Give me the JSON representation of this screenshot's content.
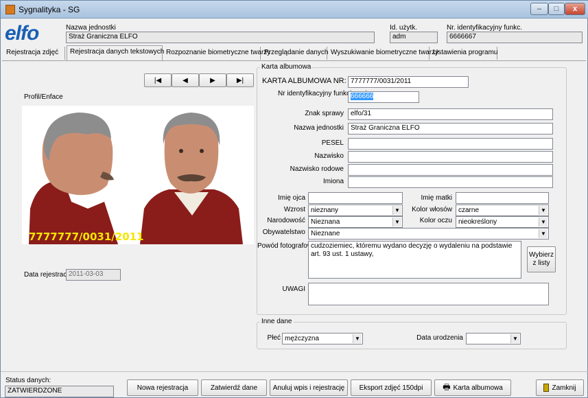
{
  "window": {
    "title": "Sygnalityka - SG",
    "controls": {
      "minimize": "–",
      "maximize": "□",
      "close": "x"
    }
  },
  "header": {
    "logo": "elfo",
    "unit_label": "Nazwa jednostki",
    "unit_value": "Straż Graniczna ELFO",
    "user_label": "Id. użytk.",
    "user_value": "adm",
    "officer_label": "Nr. identyfikacyjny funkc.",
    "officer_value": "6666667"
  },
  "tabs": [
    {
      "label": "Rejestracja zdjęć"
    },
    {
      "label": "Rejestracja danych tekstowych"
    },
    {
      "label": "Rozpoznanie biometryczne twarzy"
    },
    {
      "label": "Przeglądanie danych"
    },
    {
      "label": "Wyszukiwanie biometryczne twarzy"
    },
    {
      "label": "Ustawienia programu"
    }
  ],
  "nav": {
    "first": "|◀",
    "prev": "◀",
    "next": "▶",
    "last": "▶|"
  },
  "photo": {
    "label": "Profil/Enface",
    "caption": "7777777/0031/2011"
  },
  "registration": {
    "label": "Data rejestracji",
    "value": "2011-03-03"
  },
  "album": {
    "legend": "Karta albumowa",
    "number_label": "KARTA ALBUMOWA NR:",
    "number_value": "7777777/0031/2011",
    "officer_id_label": "Nr identyfikacyjny funkcjonariusza",
    "officer_id_value": "666666",
    "case_label": "Znak sprawy",
    "case_value": "elfo/31",
    "unit_label": "Nazwa jednostki",
    "unit_value": "Straż Graniczna ELFO",
    "pesel_label": "PESEL",
    "pesel_value": "",
    "surname_label": "Nazwisko",
    "surname_value": "",
    "family_name_label": "Nazwisko rodowe",
    "family_name_value": "",
    "first_names_label": "Imiona",
    "first_names_value": "",
    "father_label": "Imię ojca",
    "father_value": "",
    "mother_label": "Imię matki",
    "mother_value": "",
    "height_label": "Wzrost",
    "height_value": "nieznany",
    "hair_label": "Kolor włosów",
    "hair_value": "czarne",
    "nationality_label": "Narodowość",
    "nationality_value": "Nieznana",
    "eyes_label": "Kolor oczu",
    "eyes_value": "nieokreślony",
    "citizenship_label": "Obywatelstwo",
    "citizenship_value": "Nieznane",
    "reason_label": "Powód fotografowania",
    "reason_value": "cudzoziemiec, któremu wydano decyzję o wydaleniu na podstawie art. 93 ust. 1 ustawy,",
    "choose_button": "Wybierz z listy",
    "notes_label": "UWAGI",
    "notes_value": ""
  },
  "other": {
    "legend": "Inne dane",
    "sex_label": "Płeć",
    "sex_value": "mężczyzna",
    "birth_label": "Data urodzenia",
    "birth_value": ""
  },
  "status": {
    "label": "Status danych:",
    "value": "ZATWIERDZONE"
  },
  "buttons": {
    "new": "Nowa rejestracja",
    "confirm": "Zatwierdź dane",
    "cancel": "Anuluj wpis i rejestrację",
    "export": "Eksport zdjęć 150dpi",
    "card": "Karta albumowa",
    "close": "Zamknij"
  },
  "colors": {
    "logo_blue": "#1a5fb4",
    "caption_yellow": "#f5e600",
    "selection": "#3399ff"
  }
}
